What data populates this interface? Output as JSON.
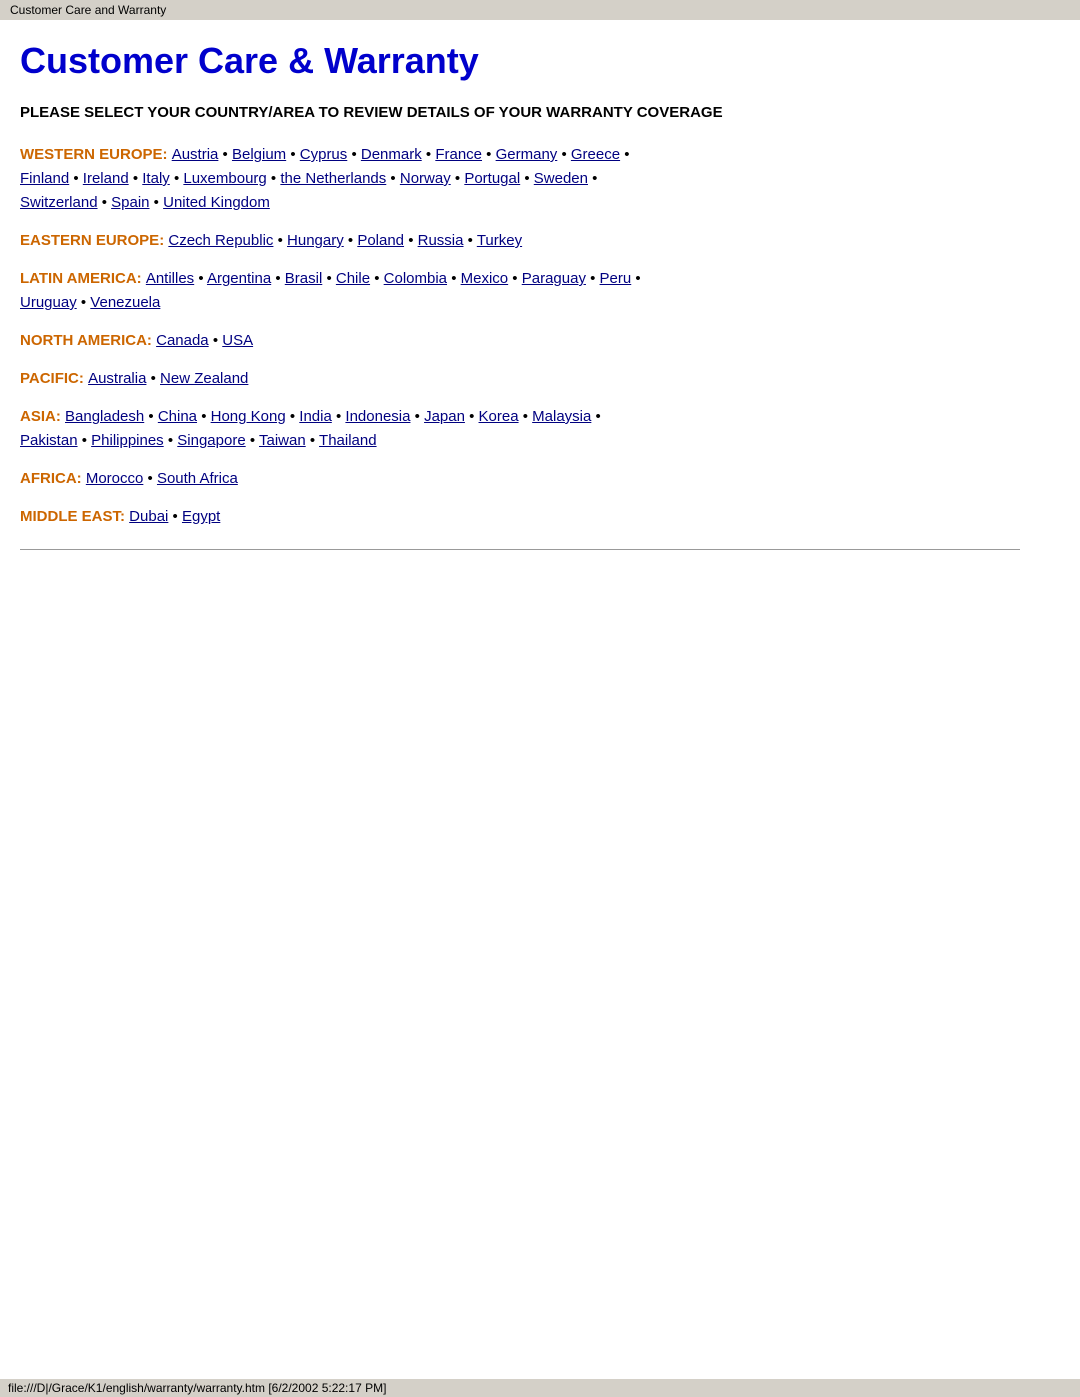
{
  "browser_tab": "Customer Care and Warranty",
  "title": "Customer Care & Warranty",
  "subtitle": "PLEASE SELECT YOUR COUNTRY/AREA TO REVIEW DETAILS OF YOUR WARRANTY COVERAGE",
  "status_bar": "file:///D|/Grace/K1/english/warranty/warranty.htm [6/2/2002 5:22:17 PM]",
  "regions": [
    {
      "id": "western-europe",
      "label": "WESTERN EUROPE:",
      "countries": [
        "Austria",
        "Belgium",
        "Cyprus",
        "Denmark",
        "France",
        "Germany",
        "Greece",
        "Finland",
        "Ireland",
        "Italy",
        "Luxembourg",
        "the Netherlands",
        "Norway",
        "Portugal",
        "Sweden",
        "Switzerland",
        "Spain",
        "United Kingdom"
      ]
    },
    {
      "id": "eastern-europe",
      "label": "EASTERN EUROPE:",
      "countries": [
        "Czech Republic",
        "Hungary",
        "Poland",
        "Russia",
        "Turkey"
      ]
    },
    {
      "id": "latin-america",
      "label": "LATIN AMERICA:",
      "countries": [
        "Antilles",
        "Argentina",
        "Brasil",
        "Chile",
        "Colombia",
        "Mexico",
        "Paraguay",
        "Peru",
        "Uruguay",
        "Venezuela"
      ]
    },
    {
      "id": "north-america",
      "label": "NORTH AMERICA:",
      "countries": [
        "Canada",
        "USA"
      ]
    },
    {
      "id": "pacific",
      "label": "PACIFIC:",
      "countries": [
        "Australia",
        "New Zealand"
      ]
    },
    {
      "id": "asia",
      "label": "ASIA:",
      "countries": [
        "Bangladesh",
        "China",
        "Hong Kong",
        "India",
        "Indonesia",
        "Japan",
        "Korea",
        "Malaysia",
        "Pakistan",
        "Philippines",
        "Singapore",
        "Taiwan",
        "Thailand"
      ]
    },
    {
      "id": "africa",
      "label": "AFRICA:",
      "countries": [
        "Morocco",
        "South Africa"
      ]
    },
    {
      "id": "middle-east",
      "label": "MIDDLE EAST:",
      "countries": [
        "Dubai",
        "Egypt"
      ]
    }
  ]
}
